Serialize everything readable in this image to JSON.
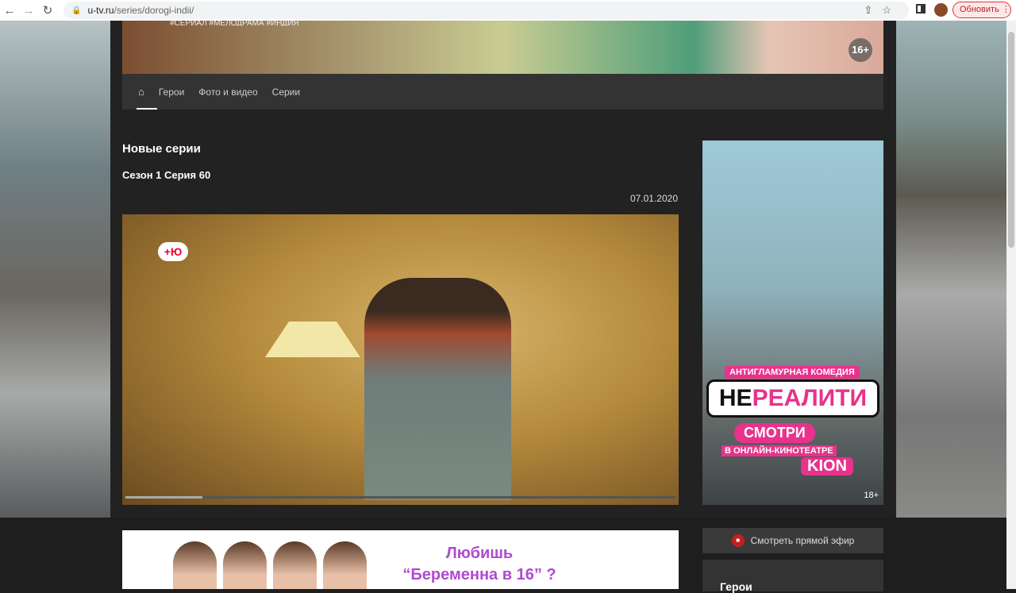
{
  "browser": {
    "url_host": "u-tv.ru",
    "url_path": "/series/dorogi-indii/",
    "update_label": "Обновить"
  },
  "header": {
    "tags": "#СЕРИАЛ #МЕЛОДРАМА #ИНДИЯ",
    "age_rating": "16+"
  },
  "nav": {
    "items": [
      "Герои",
      "Фото и видео",
      "Серии"
    ]
  },
  "main": {
    "title": "Новые серии",
    "episode": "Сезон 1 Серия 60",
    "date": "07.01.2020",
    "video_progress": 0.14,
    "channel_logo": "+Ю"
  },
  "ad": {
    "tagline": "АНТИГЛАМУРНАЯ КОМЕДИЯ",
    "title_a": "НЕ",
    "title_b": "РЕАЛИТИ",
    "cta": "СМОТРИ",
    "sub": "В ОНЛАЙН-КИНОТЕАТРЕ",
    "brand": "KION",
    "age": "18+"
  },
  "promo": {
    "line1": "Любишь",
    "line2": "“Беременна в 16” ?"
  },
  "sidebar": {
    "live_label": "Смотреть прямой эфир",
    "heroes_title": "Герои"
  }
}
